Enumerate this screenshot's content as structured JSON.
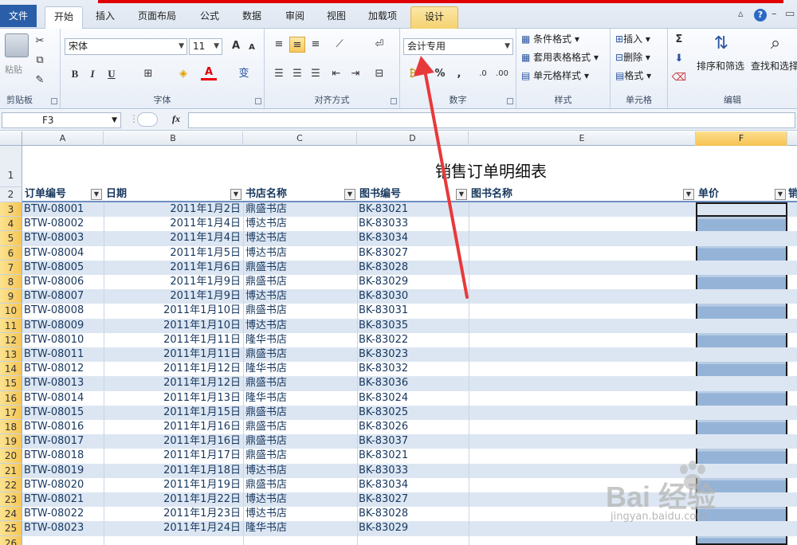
{
  "ribbon_tabs": [
    "文件",
    "开始",
    "插入",
    "页面布局",
    "公式",
    "数据",
    "审阅",
    "视图",
    "加载项",
    "设计"
  ],
  "clipboard": {
    "paste": "粘贴",
    "label": "剪贴板"
  },
  "font": {
    "name": "宋体",
    "size": "11",
    "label": "字体",
    "grow": "A",
    "shrink": "A",
    "bold": "B",
    "italic": "I",
    "underline": "U",
    "wen": "变"
  },
  "align": {
    "label": "对齐方式"
  },
  "number": {
    "format": "会计专用",
    "label": "数字",
    "percent": "%",
    "comma": ","
  },
  "styles": {
    "cond": "条件格式",
    "table": "套用表格格式",
    "cell": "单元格样式",
    "label": "样式"
  },
  "cells": {
    "insert": "插入",
    "delete": "删除",
    "format": "格式",
    "label": "单元格"
  },
  "editing": {
    "sort": "排序和筛选",
    "find": "查找和选择",
    "label": "编辑",
    "sigma": "Σ"
  },
  "namebox": "F3",
  "fx": "fx",
  "columns": [
    "A",
    "B",
    "C",
    "D",
    "E",
    "F"
  ],
  "title": "销售订单明细表",
  "headers": [
    "订单编号",
    "日期",
    "书店名称",
    "图书编号",
    "图书名称",
    "单价",
    "销"
  ],
  "rownums": [
    "1",
    "2",
    "3",
    "4",
    "5",
    "6",
    "7",
    "8",
    "9",
    "10",
    "11",
    "12",
    "13",
    "14",
    "15",
    "16",
    "17",
    "18",
    "19",
    "20",
    "21",
    "22",
    "23",
    "24",
    "25",
    "26"
  ],
  "rows": [
    [
      "BTW-08001",
      "2011年1月2日",
      "鼎盛书店",
      "BK-83021"
    ],
    [
      "BTW-08002",
      "2011年1月4日",
      "博达书店",
      "BK-83033"
    ],
    [
      "BTW-08003",
      "2011年1月4日",
      "博达书店",
      "BK-83034"
    ],
    [
      "BTW-08004",
      "2011年1月5日",
      "博达书店",
      "BK-83027"
    ],
    [
      "BTW-08005",
      "2011年1月6日",
      "鼎盛书店",
      "BK-83028"
    ],
    [
      "BTW-08006",
      "2011年1月9日",
      "鼎盛书店",
      "BK-83029"
    ],
    [
      "BTW-08007",
      "2011年1月9日",
      "博达书店",
      "BK-83030"
    ],
    [
      "BTW-08008",
      "2011年1月10日",
      "鼎盛书店",
      "BK-83031"
    ],
    [
      "BTW-08009",
      "2011年1月10日",
      "博达书店",
      "BK-83035"
    ],
    [
      "BTW-08010",
      "2011年1月11日",
      "隆华书店",
      "BK-83022"
    ],
    [
      "BTW-08011",
      "2011年1月11日",
      "鼎盛书店",
      "BK-83023"
    ],
    [
      "BTW-08012",
      "2011年1月12日",
      "隆华书店",
      "BK-83032"
    ],
    [
      "BTW-08013",
      "2011年1月12日",
      "鼎盛书店",
      "BK-83036"
    ],
    [
      "BTW-08014",
      "2011年1月13日",
      "隆华书店",
      "BK-83024"
    ],
    [
      "BTW-08015",
      "2011年1月15日",
      "鼎盛书店",
      "BK-83025"
    ],
    [
      "BTW-08016",
      "2011年1月16日",
      "鼎盛书店",
      "BK-83026"
    ],
    [
      "BTW-08017",
      "2011年1月16日",
      "鼎盛书店",
      "BK-83037"
    ],
    [
      "BTW-08018",
      "2011年1月17日",
      "鼎盛书店",
      "BK-83021"
    ],
    [
      "BTW-08019",
      "2011年1月18日",
      "博达书店",
      "BK-83033"
    ],
    [
      "BTW-08020",
      "2011年1月19日",
      "鼎盛书店",
      "BK-83034"
    ],
    [
      "BTW-08021",
      "2011年1月22日",
      "博达书店",
      "BK-83027"
    ],
    [
      "BTW-08022",
      "2011年1月23日",
      "博达书店",
      "BK-83028"
    ],
    [
      "BTW-08023",
      "2011年1月24日",
      "隆华书店",
      "BK-83029"
    ]
  ],
  "watermark": {
    "brand": "Bai 经验",
    "url": "jingyan.baidu.com"
  },
  "colors": {
    "accent": "#2a5ea8",
    "arrow": "#e8393a",
    "band": "#dce6f2",
    "selection": "#95b3d7"
  }
}
